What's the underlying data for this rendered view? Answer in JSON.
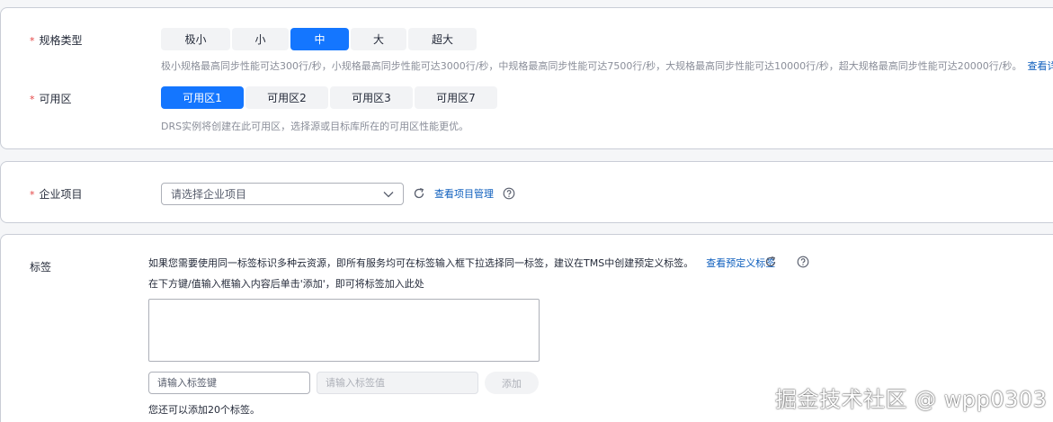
{
  "spec": {
    "label": "规格类型",
    "required_mark": "*",
    "options": [
      "极小",
      "小",
      "中",
      "大",
      "超大"
    ],
    "selected": "中",
    "hint": "极小规格最高同步性能可达300行/秒，小规格最高同步性能可达3000行/秒，中规格最高同步性能可达7500行/秒，大规格最高同步性能可达10000行/秒，超大规格最高同步性能可达20000行/秒。",
    "hint_link": "查看详细说明"
  },
  "az": {
    "label": "可用区",
    "required_mark": "*",
    "options": [
      "可用区1",
      "可用区2",
      "可用区3",
      "可用区7"
    ],
    "selected": "可用区1",
    "hint": "DRS实例将创建在此可用区，选择源或目标库所在的可用区性能更优。"
  },
  "enterprise": {
    "label": "企业项目",
    "required_mark": "*",
    "placeholder": "请选择企业项目",
    "manage_link": "查看项目管理"
  },
  "tags": {
    "label": "标签",
    "desc_line1": "如果您需要使用同一标签标识多种云资源，即所有服务均可在标签输入框下拉选择同一标签，建议在TMS中创建预定义标签。",
    "predefined_link": "查看预定义标签",
    "desc_line2": "在下方键/值输入框输入内容后单击'添加'，即可将标签加入此处",
    "key_placeholder": "请输入标签键",
    "value_placeholder": "请输入标签值",
    "add_label": "添加",
    "remaining": "您还可以添加20个标签。"
  },
  "watermark": "掘金技术社区 @ wpp0303",
  "colors": {
    "primary": "#1476ff",
    "link": "#0d5ebd",
    "required": "#e54545",
    "hint": "#8a8e99"
  },
  "icons": {
    "dropdown": "chevron-down-icon",
    "refresh": "refresh-icon",
    "help": "help-icon"
  }
}
